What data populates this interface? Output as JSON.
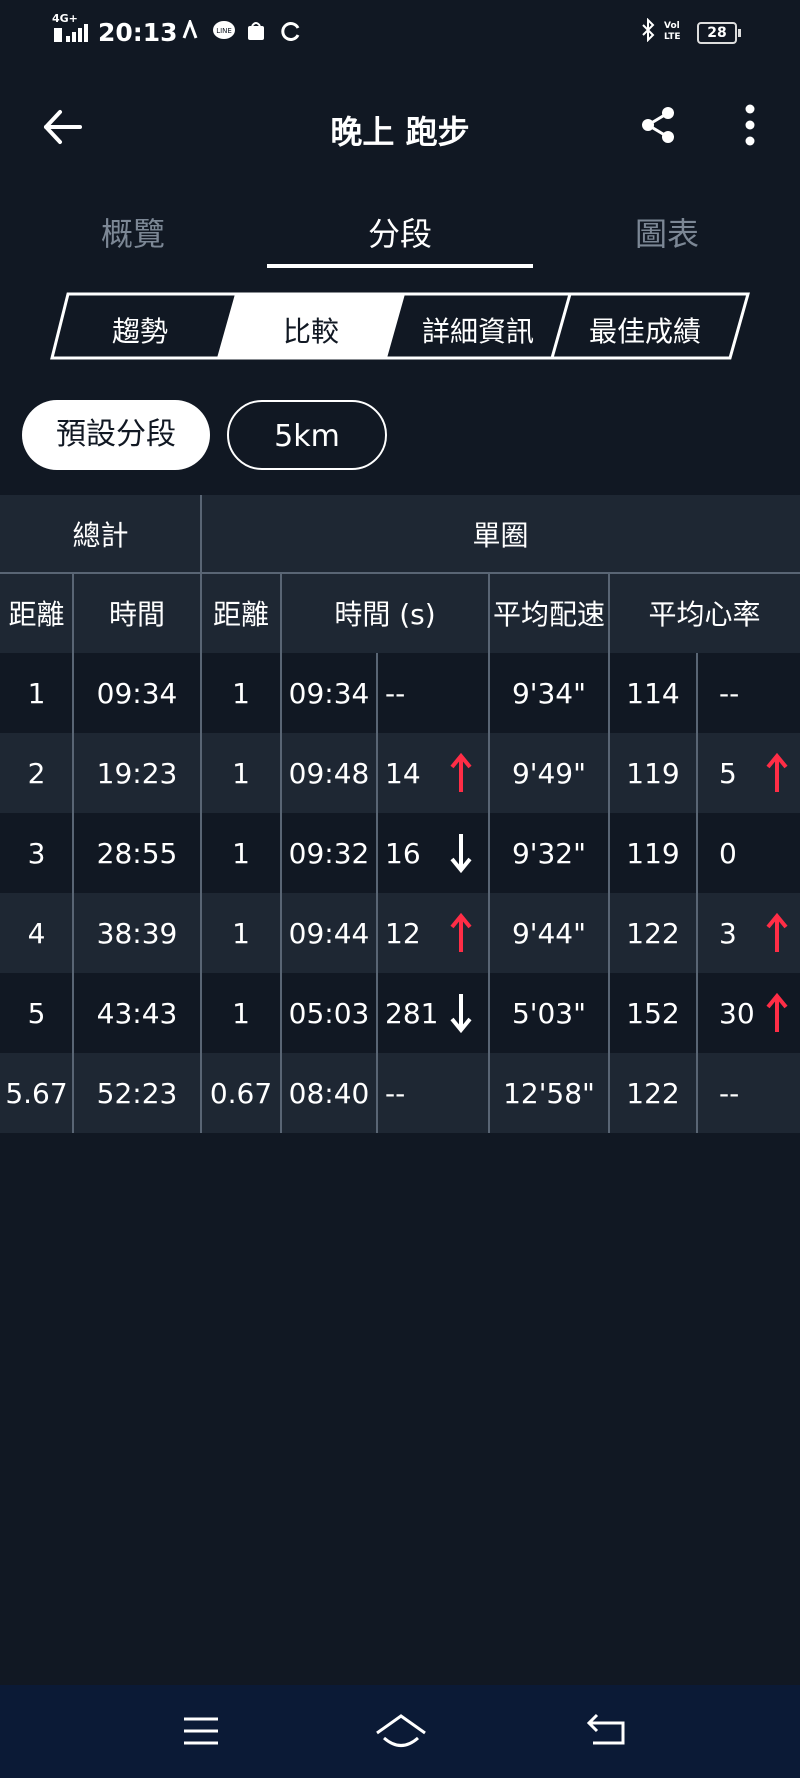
{
  "status_bar": {
    "network": "4G+",
    "time": "20:13",
    "battery": "28",
    "volte": "VoLTE"
  },
  "app_bar": {
    "title": "晚上 跑步",
    "back_icon": "arrow-left-icon",
    "share_icon": "share-icon",
    "more_icon": "more-vertical-icon"
  },
  "tabs": [
    {
      "label": "概覽",
      "active": false
    },
    {
      "label": "分段",
      "active": true
    },
    {
      "label": "圖表",
      "active": false
    }
  ],
  "segments": [
    {
      "label": "趨勢",
      "selected": false
    },
    {
      "label": "比較",
      "selected": true
    },
    {
      "label": "詳細資訊",
      "selected": false
    },
    {
      "label": "最佳成績",
      "selected": false
    }
  ],
  "pills": {
    "default_label": "預設分段",
    "km_label": "5km"
  },
  "table": {
    "group_headers": {
      "total": "總計",
      "lap": "單圈"
    },
    "headers": {
      "total_distance": "距離",
      "total_time": "時間",
      "lap_distance": "距離",
      "lap_time": "時間 (s)",
      "avg_pace": "平均配速",
      "avg_hr": "平均心率"
    },
    "rows": [
      {
        "total_distance": "1",
        "total_time": "09:34",
        "lap_distance": "1",
        "lap_time": "09:34",
        "time_delta": "--",
        "time_trend": "none",
        "pace": "9'34\"",
        "hr": "114",
        "hr_delta": "--",
        "hr_trend": "none"
      },
      {
        "total_distance": "2",
        "total_time": "19:23",
        "lap_distance": "1",
        "lap_time": "09:48",
        "time_delta": "14",
        "time_trend": "up",
        "pace": "9'49\"",
        "hr": "119",
        "hr_delta": "5",
        "hr_trend": "up"
      },
      {
        "total_distance": "3",
        "total_time": "28:55",
        "lap_distance": "1",
        "lap_time": "09:32",
        "time_delta": "16",
        "time_trend": "down",
        "pace": "9'32\"",
        "hr": "119",
        "hr_delta": "0",
        "hr_trend": "none"
      },
      {
        "total_distance": "4",
        "total_time": "38:39",
        "lap_distance": "1",
        "lap_time": "09:44",
        "time_delta": "12",
        "time_trend": "up",
        "pace": "9'44\"",
        "hr": "122",
        "hr_delta": "3",
        "hr_trend": "up"
      },
      {
        "total_distance": "5",
        "total_time": "43:43",
        "lap_distance": "1",
        "lap_time": "05:03",
        "time_delta": "281",
        "time_trend": "down",
        "pace": "5'03\"",
        "hr": "152",
        "hr_delta": "30",
        "hr_trend": "up"
      },
      {
        "total_distance": "5.67",
        "total_time": "52:23",
        "lap_distance": "0.67",
        "lap_time": "08:40",
        "time_delta": "--",
        "time_trend": "none",
        "pace": "12'58\"",
        "hr": "122",
        "hr_delta": "--",
        "hr_trend": "none"
      }
    ]
  },
  "nav_bar": {
    "menu_icon": "menu-icon",
    "home_icon": "home-icon",
    "back_icon": "back-icon"
  },
  "colors": {
    "background": "#111823",
    "row_alt": "#1e2733",
    "accent_up": "#ff2d46",
    "navbar": "#0b1a36"
  }
}
